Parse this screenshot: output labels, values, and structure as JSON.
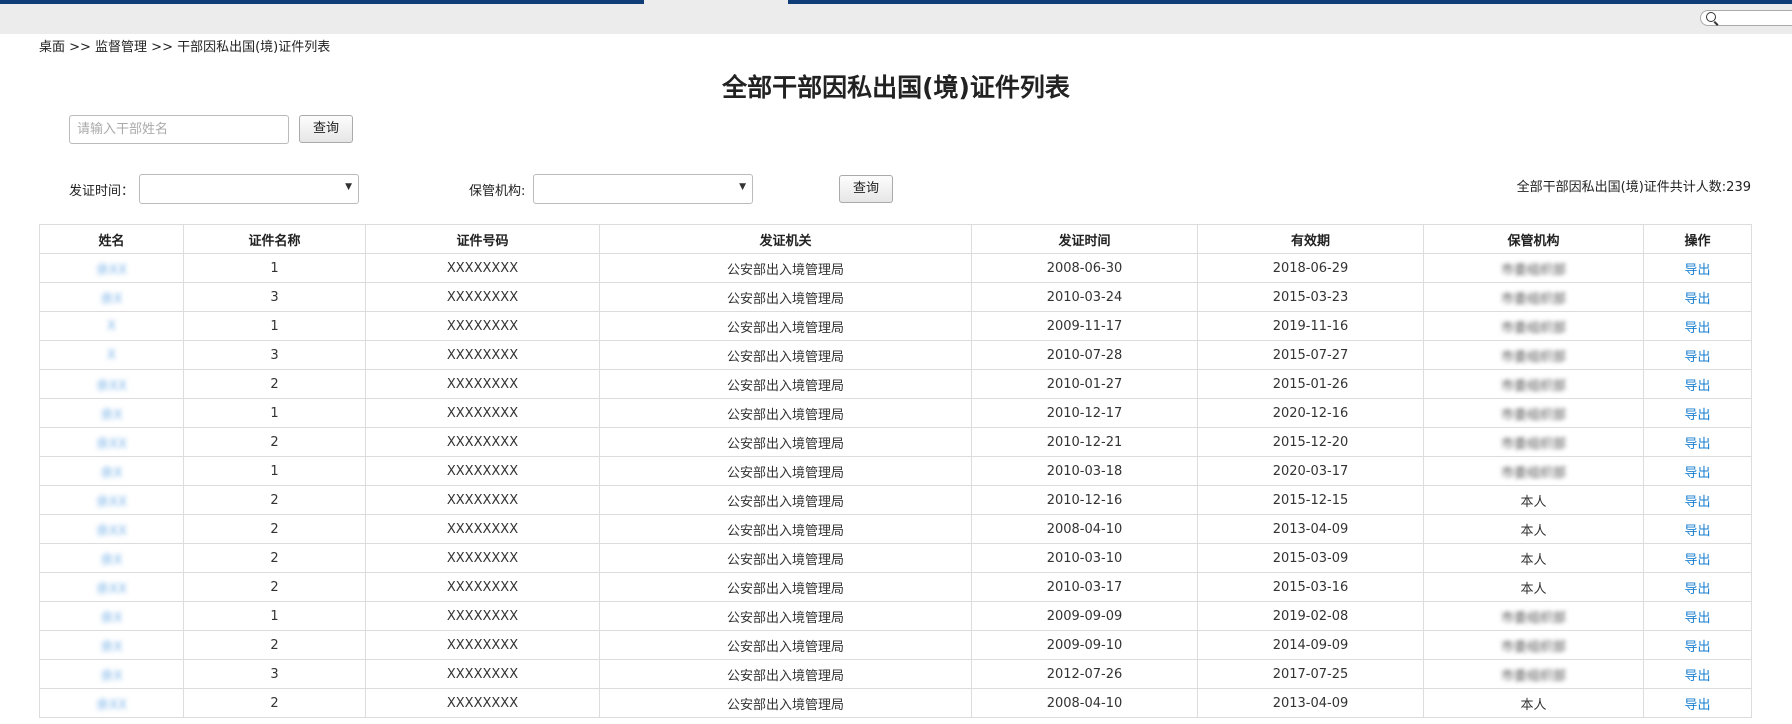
{
  "breadcrumb": "桌面 >> 监督管理 >> 干部因私出国(境)证件列表",
  "title": "全部干部因私出国(境)证件列表",
  "search": {
    "placeholder": "请输入干部姓名",
    "button": "查询"
  },
  "filters": {
    "issue_time_label": "发证时间：",
    "custody_label": "保管机构:",
    "issue_time_value": "",
    "custody_value": "",
    "button": "查询"
  },
  "total_text": "全部干部因私出国(境)证件共计人数:239",
  "table": {
    "headers": [
      "姓名",
      "证件名称",
      "证件号码",
      "发证机关",
      "发证时间",
      "有效期",
      "保管机构",
      "操作"
    ],
    "rows": [
      {
        "name": "余XX",
        "doc": "1",
        "number": "XXXXXXXX",
        "authority": "公安部出入境管理局",
        "issued": "2008-06-30",
        "expiry": "2018-06-29",
        "custody": "市委组织部",
        "op": "导出"
      },
      {
        "name": "余X",
        "doc": "3",
        "number": "XXXXXXXX",
        "authority": "公安部出入境管理局",
        "issued": "2010-03-24",
        "expiry": "2015-03-23",
        "custody": "市委组织部",
        "op": "导出"
      },
      {
        "name": "X",
        "doc": "1",
        "number": "XXXXXXXX",
        "authority": "公安部出入境管理局",
        "issued": "2009-11-17",
        "expiry": "2019-11-16",
        "custody": "市委组织部",
        "op": "导出"
      },
      {
        "name": "X",
        "doc": "3",
        "number": "XXXXXXXX",
        "authority": "公安部出入境管理局",
        "issued": "2010-07-28",
        "expiry": "2015-07-27",
        "custody": "市委组织部",
        "op": "导出"
      },
      {
        "name": "余XX",
        "doc": "2",
        "number": "XXXXXXXX",
        "authority": "公安部出入境管理局",
        "issued": "2010-01-27",
        "expiry": "2015-01-26",
        "custody": "市委组织部",
        "op": "导出"
      },
      {
        "name": "余X",
        "doc": "1",
        "number": "XXXXXXXX",
        "authority": "公安部出入境管理局",
        "issued": "2010-12-17",
        "expiry": "2020-12-16",
        "custody": "市委组织部",
        "op": "导出"
      },
      {
        "name": "余XX",
        "doc": "2",
        "number": "XXXXXXXX",
        "authority": "公安部出入境管理局",
        "issued": "2010-12-21",
        "expiry": "2015-12-20",
        "custody": "市委组织部",
        "op": "导出"
      },
      {
        "name": "余X",
        "doc": "1",
        "number": "XXXXXXXX",
        "authority": "公安部出入境管理局",
        "issued": "2010-03-18",
        "expiry": "2020-03-17",
        "custody": "市委组织部",
        "op": "导出"
      },
      {
        "name": "余XX",
        "doc": "2",
        "number": "XXXXXXXX",
        "authority": "公安部出入境管理局",
        "issued": "2010-12-16",
        "expiry": "2015-12-15",
        "custody": "本人",
        "op": "导出"
      },
      {
        "name": "余XX",
        "doc": "2",
        "number": "XXXXXXXX",
        "authority": "公安部出入境管理局",
        "issued": "2008-04-10",
        "expiry": "2013-04-09",
        "custody": "本人",
        "op": "导出"
      },
      {
        "name": "余X",
        "doc": "2",
        "number": "XXXXXXXX",
        "authority": "公安部出入境管理局",
        "issued": "2010-03-10",
        "expiry": "2015-03-09",
        "custody": "本人",
        "op": "导出"
      },
      {
        "name": "余XX",
        "doc": "2",
        "number": "XXXXXXXX",
        "authority": "公安部出入境管理局",
        "issued": "2010-03-17",
        "expiry": "2015-03-16",
        "custody": "本人",
        "op": "导出"
      },
      {
        "name": "余X",
        "doc": "1",
        "number": "XXXXXXXX",
        "authority": "公安部出入境管理局",
        "issued": "2009-09-09",
        "expiry": "2019-02-08",
        "custody": "市委组织部",
        "op": "导出"
      },
      {
        "name": "余X",
        "doc": "2",
        "number": "XXXXXXXX",
        "authority": "公安部出入境管理局",
        "issued": "2009-09-10",
        "expiry": "2014-09-09",
        "custody": "市委组织部",
        "op": "导出"
      },
      {
        "name": "余X",
        "doc": "3",
        "number": "XXXXXXXX",
        "authority": "公安部出入境管理局",
        "issued": "2012-07-26",
        "expiry": "2017-07-25",
        "custody": "市委组织部",
        "op": "导出"
      },
      {
        "name": "余XX",
        "doc": "2",
        "number": "XXXXXXXX",
        "authority": "公安部出入境管理局",
        "issued": "2008-04-10",
        "expiry": "2013-04-09",
        "custody": "本人",
        "op": "导出"
      }
    ]
  }
}
